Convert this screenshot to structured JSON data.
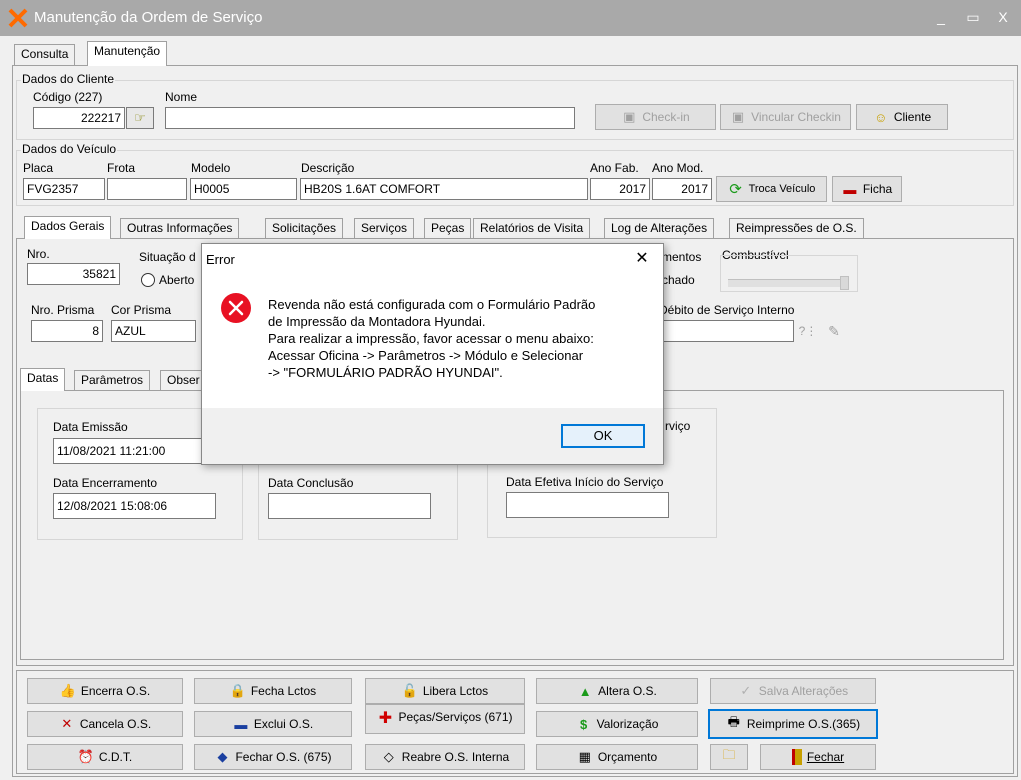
{
  "window": {
    "title": "Manutenção da Ordem de Serviço",
    "controls": [
      "_",
      "▭",
      "X"
    ]
  },
  "main_tabs": [
    "Consulta",
    "Manutenção"
  ],
  "cliente": {
    "group_title": "Dados do Cliente",
    "codigo_label": "Código (227)",
    "codigo_value": "222217",
    "nome_label": "Nome",
    "nome_value": "",
    "checkin_label": "Check-in",
    "vincular_label": "Vincular Checkin",
    "cliente_label": "Cliente"
  },
  "veiculo": {
    "group_title": "Dados do Veículo",
    "placa_label": "Placa",
    "placa_value": "FVG2357",
    "frota_label": "Frota",
    "frota_value": "",
    "modelo_label": "Modelo",
    "modelo_value": "H0005",
    "descricao_label": "Descrição",
    "descricao_value": "HB20S 1.6AT COMFORT",
    "anofab_label": "Ano Fab.",
    "anofab_value": "2017",
    "anomod_label": "Ano Mod.",
    "anomod_value": "2017",
    "troca_label": "Troca Veículo",
    "ficha_label": "Ficha"
  },
  "detail_tabs": [
    "Dados Gerais",
    "Outras Informações",
    "Solicitações",
    "Serviços",
    "Peças",
    "Relatórios de Visita",
    "Log de Alterações",
    "Reimpressões de O.S."
  ],
  "dados_gerais": {
    "nro_label": "Nro.",
    "nro_value": "35821",
    "situacao_label": "Situação d",
    "aberto_label": "Aberto",
    "lancamentos_label": "mentos",
    "fechado_label": "chado",
    "combustivel_label": "Combustível",
    "prisma_label": "Nro. Prisma",
    "prisma_value": "8",
    "cor_label": "Cor Prisma",
    "cor_value": "AZUL",
    "debito_label": "Débito de Serviço Interno"
  },
  "sub_tabs": [
    "Datas",
    "Parâmetros",
    "Obser"
  ],
  "datas": {
    "emissao_label": "Data Emissão",
    "emissao_value": "11/08/2021 11:21:00",
    "encerramento_label": "Data Encerramento",
    "encerramento_value": "12/08/2021 15:08:06",
    "conclusao_label": "Data Conclusão",
    "conclusao_value": "",
    "servico_partial_label": "rviço",
    "efetiva_label": "Data Efetiva Início do Serviço",
    "efetiva_value": ""
  },
  "actions": {
    "encerra": "Encerra O.S.",
    "fecha_lctos": "Fecha Lctos",
    "libera_lctos": "Libera Lctos",
    "altera": "Altera O.S.",
    "salva": "Salva Alterações",
    "cancela": "Cancela O.S.",
    "exclui": "Exclui O.S.",
    "pecas_servicos": "Peças/Serviços (671)",
    "valorizacao": "Valorização",
    "reimprime": "Reimprime O.S.(365)",
    "cdt": "C.D.T.",
    "fechar_os": "Fechar O.S. (675)",
    "reabre": "Reabre O.S. Interna",
    "orcamento": "Orçamento",
    "fechar": "Fechar"
  },
  "dialog": {
    "title": "Error",
    "lines": [
      "Revenda não está configurada com o Formulário Padrão",
      "de Impressão da Montadora Hyundai.",
      "Para realizar a impressão, favor acessar o menu abaixo:",
      "Acessar Oficina -> Parâmetros -> Módulo e Selecionar",
      "-> \"FORMULÁRIO PADRÃO HYUNDAI\"."
    ],
    "ok_label": "OK"
  },
  "colors": {
    "titlebar": "#a9a9a9",
    "error_icon": "#e81123",
    "focus_border": "#0078d7"
  }
}
